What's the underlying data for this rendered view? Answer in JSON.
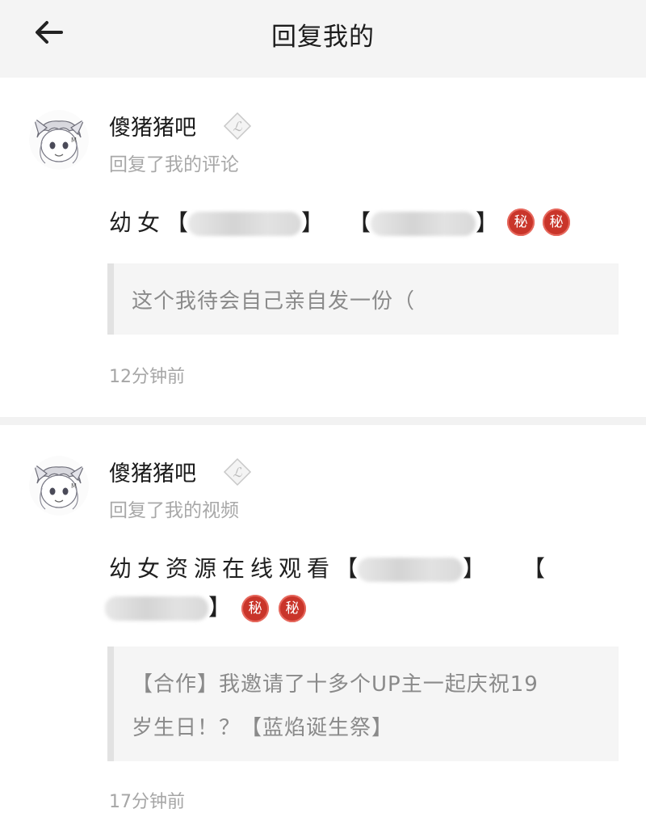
{
  "header": {
    "title": "回复我的",
    "back_icon": "arrow-left-icon"
  },
  "notifications": [
    {
      "username": "傻猪猪吧",
      "action": "回复了我的评论",
      "reply_prefix": "幼女",
      "secret_badge": "秘",
      "quote": [
        "这个我待会自己亲自发一份（"
      ],
      "time": "12分钟前"
    },
    {
      "username": "傻猪猪吧",
      "action": "回复了我的视频",
      "reply_prefix": "幼女资源在线观看",
      "secret_badge": "秘",
      "quote": [
        "【合作】我邀请了十多个UP主一起庆祝19",
        "岁生日！？【蓝焰诞生祭】"
      ],
      "time": "17分钟前"
    }
  ],
  "brackets": {
    "open": "【",
    "close": "】"
  },
  "colors": {
    "header_bg": "#f4f4f4",
    "secret_badge": "#c9352a",
    "muted_text": "#a8a8a8"
  }
}
